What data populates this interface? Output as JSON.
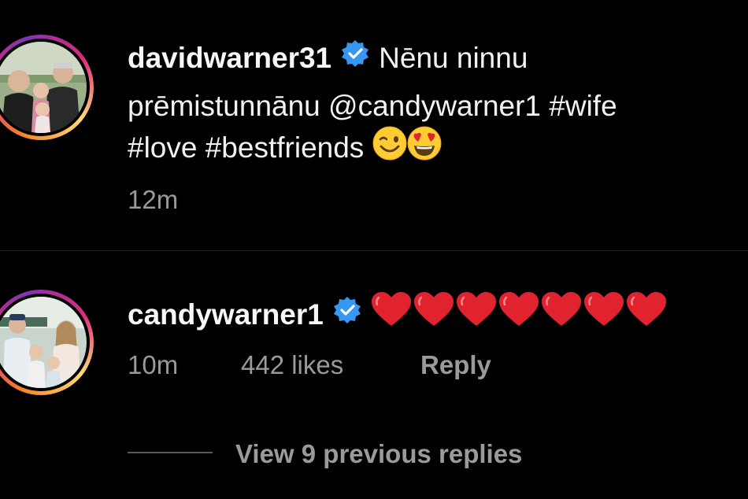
{
  "post": {
    "username": "davidwarner31",
    "verified": true,
    "caption_line1": "Nēnu ninnu",
    "caption_line2": "prēmistunnānu @candywarner1 #wife",
    "caption_line3": "#love #bestfriends",
    "caption_emojis": [
      "winking-face",
      "smiling-face-with-heart-eyes"
    ],
    "time": "12m"
  },
  "comment": {
    "username": "candywarner1",
    "verified": true,
    "hearts_count": 7,
    "time": "10m",
    "likes": "442 likes",
    "reply_label": "Reply"
  },
  "replies": {
    "label": "View 9 previous replies"
  },
  "colors": {
    "background": "#000000",
    "text": "#f2f2f2",
    "meta": "#9a9a9a",
    "verified_badge": "#3897f0",
    "heart": "#e0232e"
  }
}
